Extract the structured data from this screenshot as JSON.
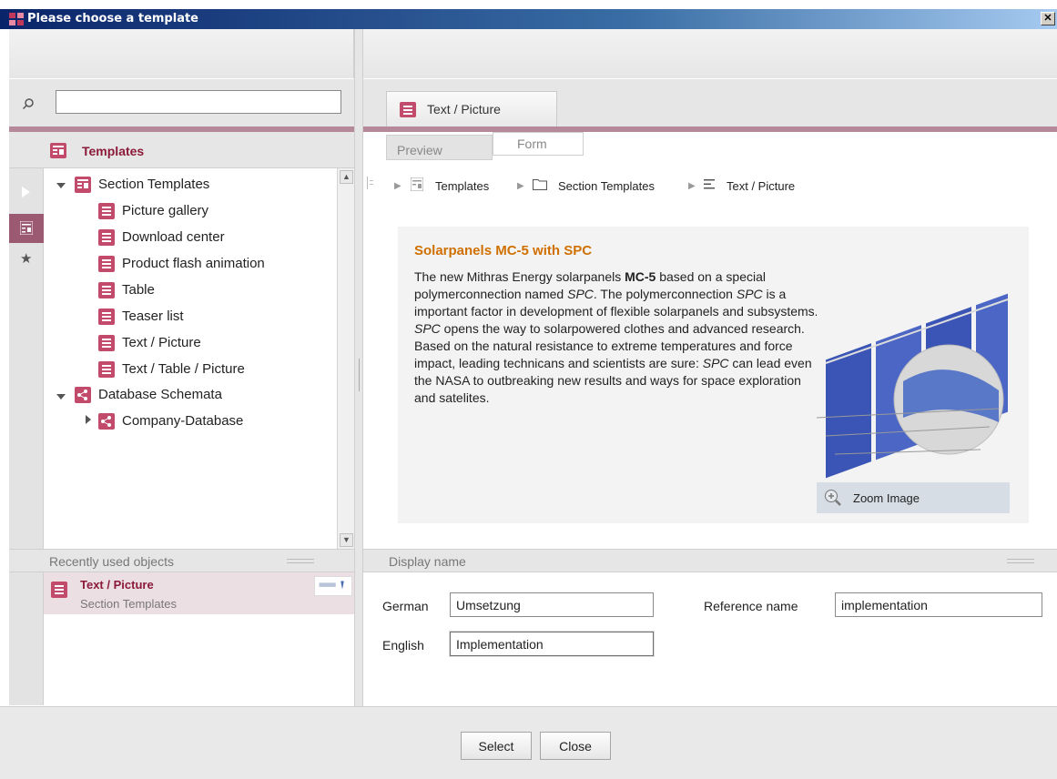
{
  "window": {
    "title": "Please choose a template",
    "close_glyph": "✕"
  },
  "search": {
    "value": "",
    "placeholder": ""
  },
  "left_header": {
    "label": "Templates",
    "icon": "templates-icon"
  },
  "tree": {
    "section_templates": "Section Templates",
    "items": [
      "Picture gallery",
      "Download center",
      "Product flash animation",
      "Table",
      "Teaser list",
      "Text / Picture",
      "Text / Table / Picture"
    ],
    "database_schemata": "Database Schemata",
    "company_database": "Company-Database"
  },
  "recent": {
    "header": "Recently used objects",
    "item_title": "Text / Picture",
    "item_subtitle": "Section Templates"
  },
  "right_tab": {
    "label": "Text / Picture"
  },
  "view_tabs": {
    "preview": "Preview",
    "form": "Form"
  },
  "breadcrumb": {
    "root": "Templates",
    "folder": "Section Templates",
    "current": "Text / Picture"
  },
  "preview": {
    "title": "Solarpanels MC-5 with SPC",
    "zoom_label": "Zoom Image"
  },
  "display": {
    "header": "Display name",
    "german_label": "German",
    "german_value": "Umsetzung",
    "english_label": "English",
    "english_value": "Implementation",
    "reference_label": "Reference name",
    "reference_value": "implementation"
  },
  "buttons": {
    "select": "Select",
    "close": "Close"
  },
  "colors": {
    "accent": "#8b1a3a",
    "accent_line": "#b5889a",
    "title_orange": "#d07000",
    "title_bar": "#0a246a"
  }
}
